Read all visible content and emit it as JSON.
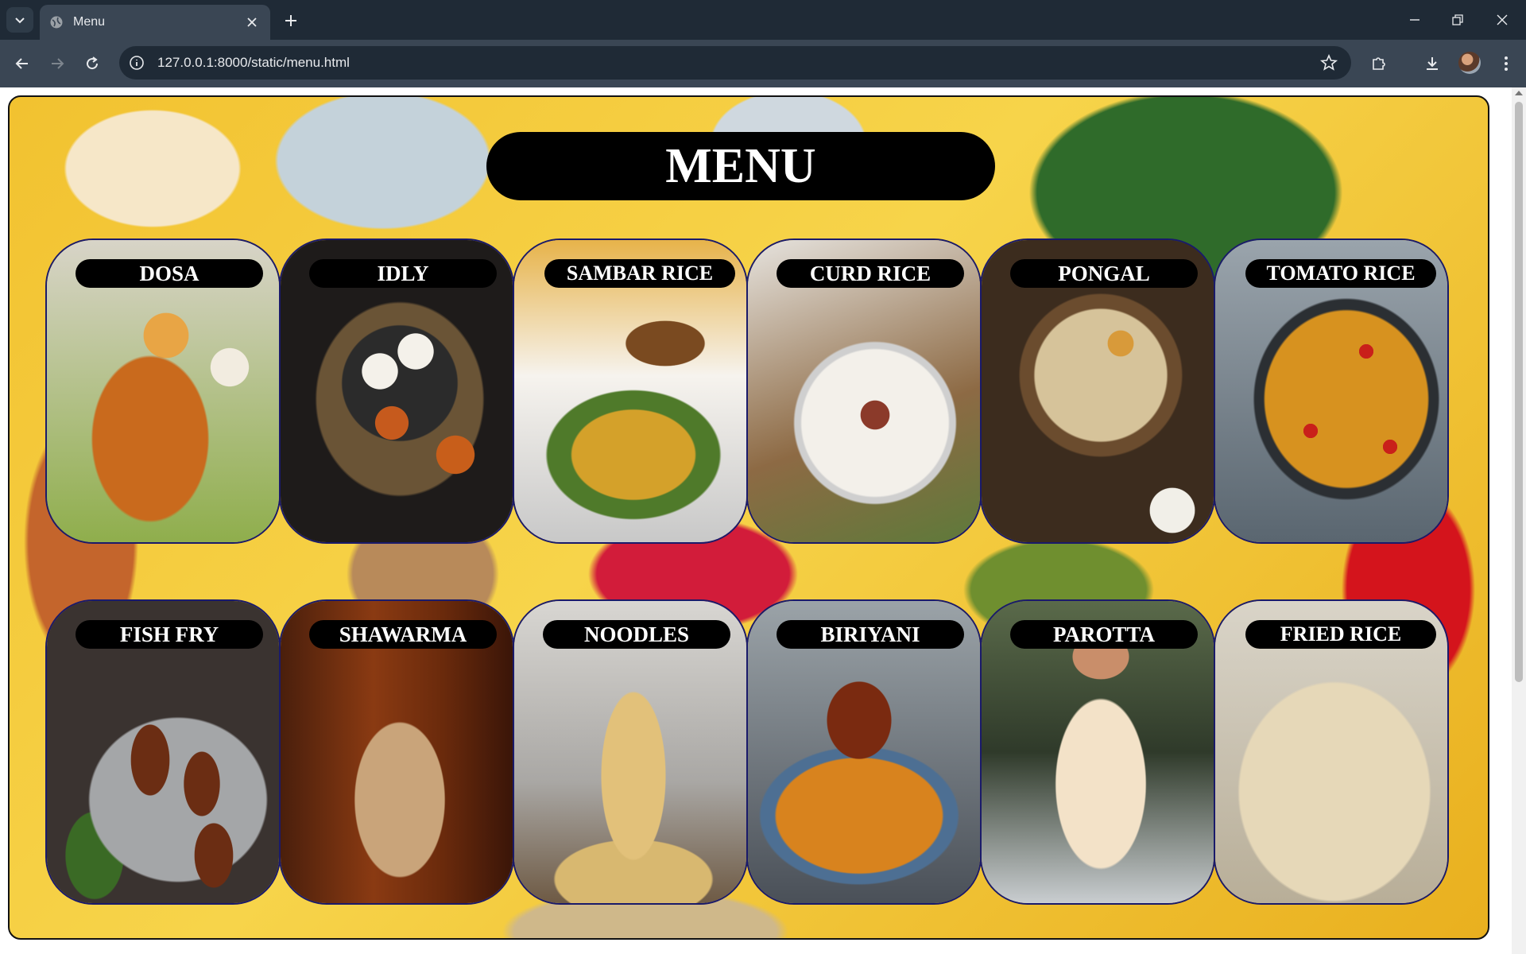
{
  "browser": {
    "tab_title": "Menu",
    "url": "127.0.0.1:8000/static/menu.html"
  },
  "page": {
    "title": "MENU",
    "items": [
      {
        "label": "DOSA",
        "image": "dosa"
      },
      {
        "label": "IDLY",
        "image": "idly"
      },
      {
        "label": "SAMBAR RICE",
        "image": "sambar-rice"
      },
      {
        "label": "CURD RICE",
        "image": "curd-rice"
      },
      {
        "label": "PONGAL",
        "image": "pongal"
      },
      {
        "label": "TOMATO RICE",
        "image": "tomato-rice"
      },
      {
        "label": "FISH FRY",
        "image": "fish-fry"
      },
      {
        "label": "SHAWARMA",
        "image": "shawarma"
      },
      {
        "label": "NOODLES",
        "image": "noodles"
      },
      {
        "label": "BIRIYANI",
        "image": "biriyani"
      },
      {
        "label": "PAROTTA",
        "image": "parotta"
      },
      {
        "label": "FRIED RICE",
        "image": "fried-rice"
      }
    ]
  },
  "colors": {
    "chrome_dark": "#1f2a36",
    "chrome_mid": "#3a4654",
    "background_yellow": "#f2c230",
    "card_border": "#1a1a6a",
    "label_bg": "#000000"
  }
}
